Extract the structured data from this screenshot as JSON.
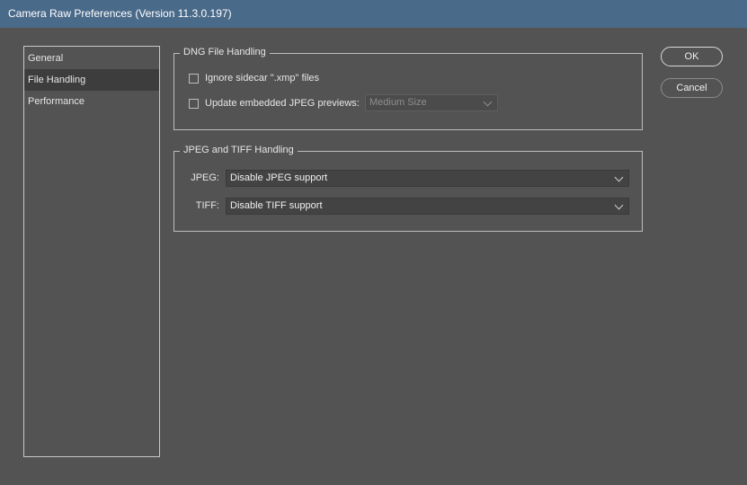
{
  "window": {
    "title": "Camera Raw Preferences  (Version 11.3.0.197)"
  },
  "sidebar": {
    "items": [
      {
        "label": "General"
      },
      {
        "label": "File Handling"
      },
      {
        "label": "Performance"
      }
    ],
    "selected": "File Handling"
  },
  "dng": {
    "legend": "DNG File Handling",
    "ignore_sidecar": {
      "label": "Ignore sidecar \".xmp\" files",
      "checked": false
    },
    "update_previews": {
      "label": "Update embedded JPEG previews:",
      "checked": false
    },
    "preview_size": {
      "value": "Medium Size",
      "disabled": true
    }
  },
  "jpeg_tiff": {
    "legend": "JPEG and TIFF Handling",
    "jpeg": {
      "label": "JPEG:",
      "value": "Disable JPEG support"
    },
    "tiff": {
      "label": "TIFF:",
      "value": "Disable TIFF support"
    }
  },
  "buttons": {
    "ok": "OK",
    "cancel": "Cancel"
  },
  "colors": {
    "titlebar": "#4a6a8a",
    "background": "#535353",
    "selected_item": "#3d3d3d"
  }
}
